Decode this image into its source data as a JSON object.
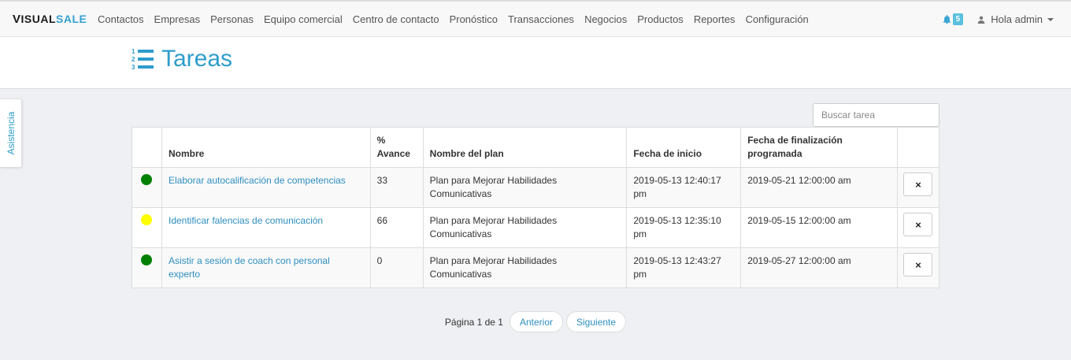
{
  "brand": {
    "prefix": "V",
    "part1": "ISUAL",
    "part2": "SALE"
  },
  "nav": {
    "items": [
      "Contactos",
      "Empresas",
      "Personas",
      "Equipo comercial",
      "Centro de contacto",
      "Pronóstico",
      "Transacciones",
      "Negocios",
      "Productos",
      "Reportes",
      "Configuración"
    ],
    "notifications_count": "5",
    "user_label": "Hola admin"
  },
  "page": {
    "title": "Tareas"
  },
  "side_tab": {
    "label": "Asistencia"
  },
  "search": {
    "placeholder": "Buscar tarea"
  },
  "table": {
    "headers": {
      "status": "",
      "name": "Nombre",
      "progress": "% Avance",
      "plan": "Nombre del plan",
      "start": "Fecha de inicio",
      "end": "Fecha de finalización programada",
      "actions": ""
    },
    "rows": [
      {
        "status_color": "#008000",
        "name": "Elaborar autocalificación de competencias",
        "progress": "33",
        "plan": "Plan para Mejorar Habilidades Comunicativas",
        "start": "2019-05-13 12:40:17 pm",
        "end": "2019-05-21 12:00:00 am",
        "delete_label": "×"
      },
      {
        "status_color": "#ffff00",
        "name": "Identificar falencias de comunicación",
        "progress": "66",
        "plan": "Plan para Mejorar Habilidades Comunicativas",
        "start": "2019-05-13 12:35:10 pm",
        "end": "2019-05-15 12:00:00 am",
        "delete_label": "×"
      },
      {
        "status_color": "#008000",
        "name": "Asistir a sesión de coach con personal experto",
        "progress": "0",
        "plan": "Plan para Mejorar Habilidades Comunicativas",
        "start": "2019-05-13 12:43:27 pm",
        "end": "2019-05-27 12:00:00 am",
        "delete_label": "×"
      }
    ]
  },
  "pagination": {
    "label": "Página 1 de 1",
    "prev": "Anterior",
    "next": "Siguiente"
  },
  "icons": {
    "bell": "bell-icon",
    "user": "user-icon",
    "title": "ordered-list-icon"
  },
  "colors": {
    "accent": "#2e9ccc",
    "link": "#2e8fc0",
    "badge": "#5bc0de"
  }
}
